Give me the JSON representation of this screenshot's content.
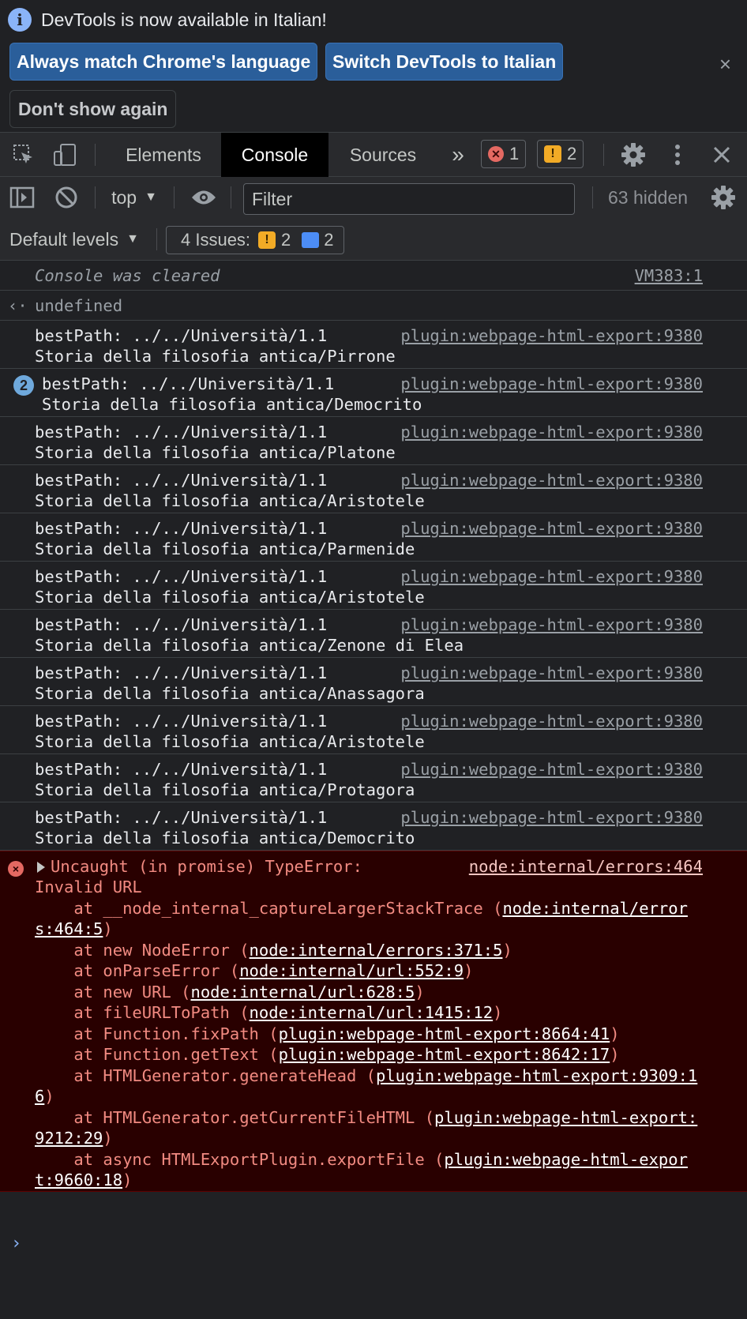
{
  "infobar": {
    "message": "DevTools is now available in Italian!",
    "info_icon": "i",
    "buttons": {
      "match": "Always match Chrome's language",
      "switch": "Switch DevTools to Italian",
      "dont_show": "Don't show again"
    },
    "close": "×"
  },
  "tabs": {
    "elements": "Elements",
    "console": "Console",
    "sources": "Sources",
    "more": "»",
    "error_count": "1",
    "warning_count": "2",
    "active": "Console"
  },
  "toolbar": {
    "context": "top",
    "filter_placeholder": "Filter",
    "hidden": "63 hidden",
    "levels": "Default levels",
    "issues_label": "4 Issues:",
    "issues_warnings": "2",
    "issues_info": "2"
  },
  "console": {
    "cleared": {
      "text": "Console was cleared",
      "source": "VM383:1"
    },
    "result": {
      "arrow": "‹·",
      "text": "undefined"
    },
    "logs": [
      {
        "line1": "bestPath: ../../Università/1.1",
        "line2": "Storia della filosofia antica/Pirrone",
        "source": "plugin:webpage-html-export:9380",
        "repeat": ""
      },
      {
        "line1": "bestPath: ../../Università/1.1",
        "line2": "Storia della filosofia antica/Democrito",
        "source": "plugin:webpage-html-export:9380",
        "repeat": "2"
      },
      {
        "line1": "bestPath: ../../Università/1.1",
        "line2": "Storia della filosofia antica/Platone",
        "source": "plugin:webpage-html-export:9380",
        "repeat": ""
      },
      {
        "line1": "bestPath: ../../Università/1.1",
        "line2": "Storia della filosofia antica/Aristotele",
        "source": "plugin:webpage-html-export:9380",
        "repeat": ""
      },
      {
        "line1": "bestPath: ../../Università/1.1",
        "line2": "Storia della filosofia antica/Parmenide",
        "source": "plugin:webpage-html-export:9380",
        "repeat": ""
      },
      {
        "line1": "bestPath: ../../Università/1.1",
        "line2": "Storia della filosofia antica/Aristotele",
        "source": "plugin:webpage-html-export:9380",
        "repeat": ""
      },
      {
        "line1": "bestPath: ../../Università/1.1",
        "line2": "Storia della filosofia antica/Zenone di Elea",
        "source": "plugin:webpage-html-export:9380",
        "repeat": ""
      },
      {
        "line1": "bestPath: ../../Università/1.1",
        "line2": "Storia della filosofia antica/Anassagora",
        "source": "plugin:webpage-html-export:9380",
        "repeat": ""
      },
      {
        "line1": "bestPath: ../../Università/1.1",
        "line2": "Storia della filosofia antica/Aristotele",
        "source": "plugin:webpage-html-export:9380",
        "repeat": ""
      },
      {
        "line1": "bestPath: ../../Università/1.1",
        "line2": "Storia della filosofia antica/Protagora",
        "source": "plugin:webpage-html-export:9380",
        "repeat": ""
      },
      {
        "line1": "bestPath: ../../Università/1.1",
        "line2": "Storia della filosofia antica/Democrito",
        "source": "plugin:webpage-html-export:9380",
        "repeat": ""
      }
    ],
    "error": {
      "icon": "×",
      "head": "Uncaught (in promise) TypeError:",
      "message": "Invalid URL",
      "source": "node:internal/errors:464",
      "stack": [
        {
          "prefix": "    at __node_internal_captureLargerStackTrace (",
          "link": "node:internal/errors:464:5",
          "suffix": ")"
        },
        {
          "prefix": "    at new NodeError (",
          "link": "node:internal/errors:371:5",
          "suffix": ")"
        },
        {
          "prefix": "    at onParseError (",
          "link": "node:internal/url:552:9",
          "suffix": ")"
        },
        {
          "prefix": "    at new URL (",
          "link": "node:internal/url:628:5",
          "suffix": ")"
        },
        {
          "prefix": "    at fileURLToPath (",
          "link": "node:internal/url:1415:12",
          "suffix": ")"
        },
        {
          "prefix": "    at Function.fixPath (",
          "link": "plugin:webpage-html-export:8664:41",
          "suffix": ")"
        },
        {
          "prefix": "    at Function.getText (",
          "link": "plugin:webpage-html-export:8642:17",
          "suffix": ")"
        },
        {
          "prefix": "    at HTMLGenerator.generateHead (",
          "link": "plugin:webpage-html-export:9309:16",
          "suffix": ")"
        },
        {
          "prefix": "    at HTMLGenerator.getCurrentFileHTML (",
          "link": "plugin:webpage-html-export:9212:29",
          "suffix": ")"
        },
        {
          "prefix": "    at async HTMLExportPlugin.exportFile (",
          "link": "plugin:webpage-html-export:9660:18",
          "suffix": ")"
        }
      ]
    },
    "prompt": "›"
  },
  "colors": {
    "background": "#202124",
    "error_bg": "#290000",
    "error_text": "#f28b82",
    "accent_button": "#2a5e9a",
    "warning": "#f2ab26",
    "error_badge": "#e46962"
  },
  "icons": {
    "inspect": "inspect-element-icon",
    "device": "device-toolbar-icon",
    "settings": "gear-icon",
    "menu": "kebab-menu-icon",
    "close": "close-icon",
    "sidebar": "sidebar-toggle-icon",
    "clear": "clear-console-icon",
    "live": "eye-icon"
  }
}
